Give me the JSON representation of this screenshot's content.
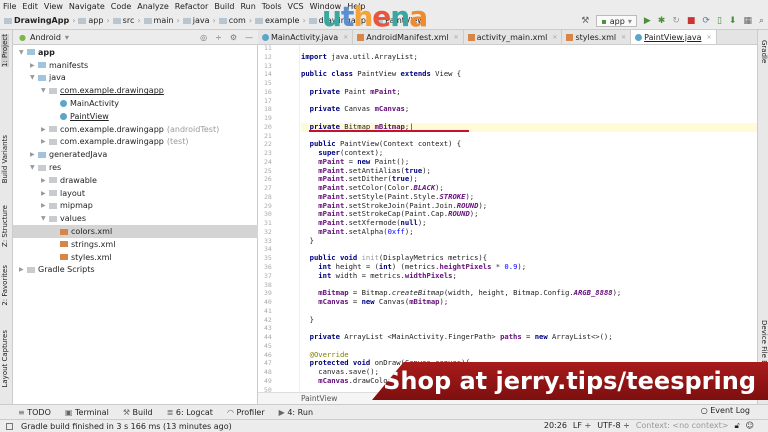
{
  "menu": [
    "File",
    "Edit",
    "View",
    "Navigate",
    "Code",
    "Analyze",
    "Refactor",
    "Build",
    "Run",
    "Tools",
    "VCS",
    "Window",
    "Help"
  ],
  "breadcrumbs": [
    "DrawingApp",
    "app",
    "src",
    "main",
    "java",
    "com",
    "example",
    "drawingapp",
    "PaintView"
  ],
  "run_config": "app",
  "logo": {
    "letters": [
      "u",
      "t",
      "h",
      "e",
      "n",
      "a"
    ],
    "colors": [
      "#3aa7a0",
      "#5a8fd0",
      "#f2a33a",
      "#e8543c",
      "#3aa7a0",
      "#f08a2e"
    ]
  },
  "left_stripe": [
    "1: Project",
    "Build Variants",
    "Z: Structure",
    "2: Favorites",
    "Layout Captures"
  ],
  "right_stripe": [
    "Gradle",
    "Device File Explorer"
  ],
  "project": {
    "view": "Android",
    "tree": [
      {
        "label": "app",
        "depth": 0,
        "arrow": "▼",
        "icon": "folder",
        "bold": true
      },
      {
        "label": "manifests",
        "depth": 1,
        "arrow": "▶",
        "icon": "folder"
      },
      {
        "label": "java",
        "depth": 1,
        "arrow": "▼",
        "icon": "folder"
      },
      {
        "label": "com.example.drawingapp",
        "depth": 2,
        "arrow": "▼",
        "icon": "pkg",
        "underline": true
      },
      {
        "label": "MainActivity",
        "depth": 3,
        "arrow": "",
        "icon": "cls"
      },
      {
        "label": "PaintView",
        "depth": 3,
        "arrow": "",
        "icon": "cls",
        "underline": true
      },
      {
        "label": "com.example.drawingapp",
        "depth": 2,
        "arrow": "▶",
        "icon": "pkg",
        "suffix": "(androidTest)"
      },
      {
        "label": "com.example.drawingapp",
        "depth": 2,
        "arrow": "▶",
        "icon": "pkg",
        "suffix": "(test)"
      },
      {
        "label": "generatedJava",
        "depth": 1,
        "arrow": "▶",
        "icon": "folder"
      },
      {
        "label": "res",
        "depth": 1,
        "arrow": "▼",
        "icon": "pkg"
      },
      {
        "label": "drawable",
        "depth": 2,
        "arrow": "▶",
        "icon": "pkg"
      },
      {
        "label": "layout",
        "depth": 2,
        "arrow": "▶",
        "icon": "pkg"
      },
      {
        "label": "mipmap",
        "depth": 2,
        "arrow": "▶",
        "icon": "pkg"
      },
      {
        "label": "values",
        "depth": 2,
        "arrow": "▼",
        "icon": "pkg"
      },
      {
        "label": "colors.xml",
        "depth": 3,
        "arrow": "",
        "icon": "xml",
        "selected": true
      },
      {
        "label": "strings.xml",
        "depth": 3,
        "arrow": "",
        "icon": "xml"
      },
      {
        "label": "styles.xml",
        "depth": 3,
        "arrow": "",
        "icon": "xml"
      },
      {
        "label": "Gradle Scripts",
        "depth": 0,
        "arrow": "▶",
        "icon": "pkg"
      }
    ]
  },
  "tabs": [
    {
      "label": "MainActivity.java",
      "icon": "class",
      "active": false
    },
    {
      "label": "AndroidManifest.xml",
      "icon": "xml",
      "active": false
    },
    {
      "label": "activity_main.xml",
      "icon": "xml",
      "active": false
    },
    {
      "label": "styles.xml",
      "icon": "xml",
      "active": false
    },
    {
      "label": "PaintView.java",
      "icon": "class",
      "active": true
    }
  ],
  "editor": {
    "first_line": 11,
    "current_line": 20,
    "lines": [
      [],
      [
        [
          "import",
          "kw"
        ],
        [
          " java.util.ArrayList;",
          ""
        ]
      ],
      [],
      [
        [
          "public class ",
          "kw"
        ],
        [
          "PaintView ",
          ""
        ],
        [
          "extends ",
          "kw"
        ],
        [
          "View {",
          ""
        ]
      ],
      [],
      [
        [
          "  private ",
          "kw"
        ],
        [
          "Paint ",
          ""
        ],
        [
          "mPaint",
          "fld"
        ],
        [
          ";",
          ""
        ]
      ],
      [],
      [
        [
          "  private ",
          "kw"
        ],
        [
          "Canvas ",
          ""
        ],
        [
          "mCanvas",
          "fld"
        ],
        [
          ";",
          ""
        ]
      ],
      [],
      [
        [
          "  private ",
          "kw"
        ],
        [
          "Bitmap ",
          ""
        ],
        [
          "mBitmap",
          "fld"
        ],
        [
          ";|",
          ""
        ]
      ],
      [],
      [
        [
          "  public ",
          "kw"
        ],
        [
          "PaintView(Context context) {",
          ""
        ]
      ],
      [
        [
          "    super",
          "kw"
        ],
        [
          "(context);",
          ""
        ]
      ],
      [
        [
          "    mPaint",
          "fld"
        ],
        [
          " = ",
          ""
        ],
        [
          "new ",
          "kw"
        ],
        [
          "Paint();",
          ""
        ]
      ],
      [
        [
          "    mPaint",
          "fld"
        ],
        [
          ".setAntiAlias(",
          ""
        ],
        [
          "true",
          "kw"
        ],
        [
          ");",
          ""
        ]
      ],
      [
        [
          "    mPaint",
          "fld"
        ],
        [
          ".setDither(",
          ""
        ],
        [
          "true",
          "kw"
        ],
        [
          ");",
          ""
        ]
      ],
      [
        [
          "    mPaint",
          "fld"
        ],
        [
          ".setColor(Color.",
          ""
        ],
        [
          "BLACK",
          "st"
        ],
        [
          ");",
          ""
        ]
      ],
      [
        [
          "    mPaint",
          "fld"
        ],
        [
          ".setStyle(Paint.Style.",
          ""
        ],
        [
          "STROKE",
          "st"
        ],
        [
          ");",
          ""
        ]
      ],
      [
        [
          "    mPaint",
          "fld"
        ],
        [
          ".setStrokeJoin(Paint.Join.",
          ""
        ],
        [
          "ROUND",
          "st"
        ],
        [
          ");",
          ""
        ]
      ],
      [
        [
          "    mPaint",
          "fld"
        ],
        [
          ".setStrokeCap(Paint.Cap.",
          ""
        ],
        [
          "ROUND",
          "st"
        ],
        [
          ");",
          ""
        ]
      ],
      [
        [
          "    mPaint",
          "fld"
        ],
        [
          ".setXfermode(",
          ""
        ],
        [
          "null",
          "kw"
        ],
        [
          ");",
          ""
        ]
      ],
      [
        [
          "    mPaint",
          "fld"
        ],
        [
          ".setAlpha(",
          ""
        ],
        [
          "0xff",
          "num"
        ],
        [
          ");",
          ""
        ]
      ],
      [
        [
          "  }",
          ""
        ]
      ],
      [],
      [
        [
          "  public void ",
          "kw"
        ],
        [
          "init",
          "fn"
        ],
        [
          "(DisplayMetrics metrics){",
          ""
        ]
      ],
      [
        [
          "    int ",
          "kw"
        ],
        [
          "height = (",
          ""
        ],
        [
          "int",
          "kw"
        ],
        [
          ") (metrics.",
          ""
        ],
        [
          "heightPixels",
          "fld"
        ],
        [
          " * ",
          ""
        ],
        [
          "0.9",
          "num"
        ],
        [
          ");",
          ""
        ]
      ],
      [
        [
          "    int ",
          "kw"
        ],
        [
          "width = metrics.",
          ""
        ],
        [
          "widthPixels",
          "fld"
        ],
        [
          ";",
          ""
        ]
      ],
      [],
      [
        [
          "    mBitmap",
          "fld"
        ],
        [
          " = Bitmap.",
          ""
        ],
        [
          "createBitmap",
          "it"
        ],
        [
          "(width, height, Bitmap.Config.",
          ""
        ],
        [
          "ARGB_8888",
          "st"
        ],
        [
          ");",
          ""
        ]
      ],
      [
        [
          "    mCanvas",
          "fld"
        ],
        [
          " = ",
          ""
        ],
        [
          "new ",
          "kw"
        ],
        [
          "Canvas(",
          ""
        ],
        [
          "mBitmap",
          "fld"
        ],
        [
          ");",
          ""
        ]
      ],
      [],
      [
        [
          "  }",
          ""
        ]
      ],
      [],
      [
        [
          "  private ",
          "kw"
        ],
        [
          "ArrayList <MainActivity.FingerPath> ",
          ""
        ],
        [
          "paths",
          "fld"
        ],
        [
          " = ",
          ""
        ],
        [
          "new ",
          "kw"
        ],
        [
          "ArrayList<>();",
          ""
        ]
      ],
      [],
      [
        [
          "  @Override",
          "ann"
        ]
      ],
      [
        [
          "  protected void ",
          "kw"
        ],
        [
          "onDraw(Canvas canvas){",
          ""
        ]
      ],
      [
        [
          "    canvas.save();",
          ""
        ]
      ],
      [
        [
          "    mCanvas",
          "fld"
        ],
        [
          ".drawColor(",
          ""
        ]
      ],
      []
    ]
  },
  "editor_breadcrumb": "PaintView",
  "banner": "Shop at jerry.tips/teespring",
  "bottom_tools": [
    "TODO",
    "Terminal",
    "Build",
    "6: Logcat",
    "Profiler",
    "4: Run"
  ],
  "event_log": "Event Log",
  "status": {
    "message": "Gradle build finished in 3 s 166 ms (13 minutes ago)",
    "position": "20:26",
    "line_sep": "LF ÷",
    "encoding": "UTF-8 ÷",
    "context": "Context: <no context>"
  }
}
